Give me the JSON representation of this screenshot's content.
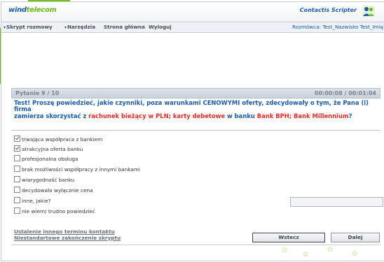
{
  "header": {
    "logo_main": "wind",
    "logo_accent": "telecom",
    "brand": "Contactis Scripter"
  },
  "menu": {
    "items": [
      {
        "label": "Skrypt rozmowy",
        "dropdown": true
      },
      {
        "label": "Narzędzia",
        "dropdown": true
      },
      {
        "label": "Strona główna",
        "dropdown": false
      },
      {
        "label": "Wyloguj",
        "dropdown": false
      }
    ],
    "operator": "Rozmówca: Test_Nazwisko Test_Imię"
  },
  "panel": {
    "question_counter": "Pytanie 9 / 10",
    "timer": "00:00:08 / 00:01:04"
  },
  "question": {
    "line1": "Test! Proszę powiedzieć, jakie czynniki, poza warunkami CENOWYMI oferty, zdecydowały o tym, że Pana (i) firma",
    "line2_a": "zamierza skorzystać z ",
    "line2_red1": "rachunek bieżący w PLN; karty debetowe",
    "line2_b": " w banku ",
    "line2_red2": "Bank BPH; Bank Millennium",
    "line2_c": "?"
  },
  "options": [
    {
      "label": "trwająca współpraca z bankiem",
      "checked": true
    },
    {
      "label": "atrakcyjna oferta banku",
      "checked": true
    },
    {
      "label": "profesjonalna obsługa",
      "checked": false
    },
    {
      "label": "brak możliwości współpracy z innymi bankami",
      "checked": false
    },
    {
      "label": "wiarygodność banku",
      "checked": false
    },
    {
      "label": "decydowała wyłącznie cena",
      "checked": false
    },
    {
      "label": "inne, jakie?",
      "checked": false
    },
    {
      "label": "nie wiem/ trudno powiedzieć",
      "checked": false
    }
  ],
  "other_input": {
    "value": ""
  },
  "footer": {
    "link1": "Ustalenie innego terminu kontaktu",
    "link2": "Niestandartowe zakończenie skryptu",
    "back_label": "Wstecz",
    "next_label": "Dalej"
  },
  "colors": {
    "brand_green": "#76bc21",
    "brand_blue": "#1c5aa6",
    "highlight_red": "#e22a2a"
  }
}
